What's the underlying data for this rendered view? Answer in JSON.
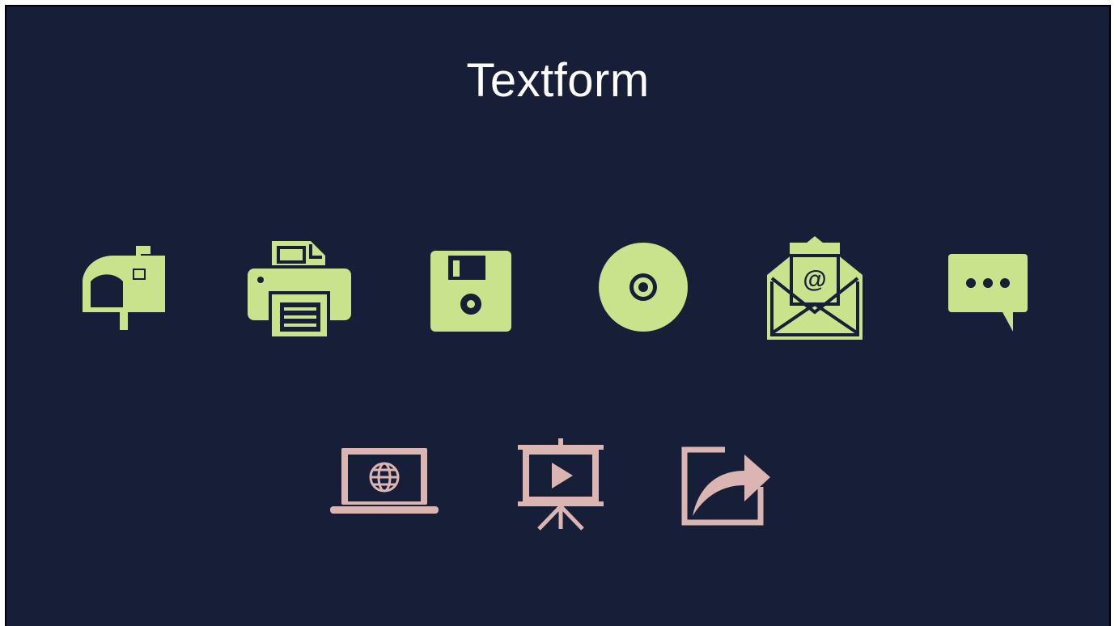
{
  "slide": {
    "title": "Textform"
  },
  "colors": {
    "background": "#161e38",
    "title": "#ffffff",
    "row1_icons": "#c8e38b",
    "row2_icons": "#dab5b2"
  },
  "icons": {
    "row1": [
      "mailbox-icon",
      "fax-printer-icon",
      "floppy-disk-icon",
      "cd-disc-icon",
      "open-envelope-email-icon",
      "speech-bubble-ellipsis-icon"
    ],
    "row2": [
      "laptop-globe-icon",
      "presentation-screen-play-icon",
      "share-arrow-icon"
    ]
  }
}
